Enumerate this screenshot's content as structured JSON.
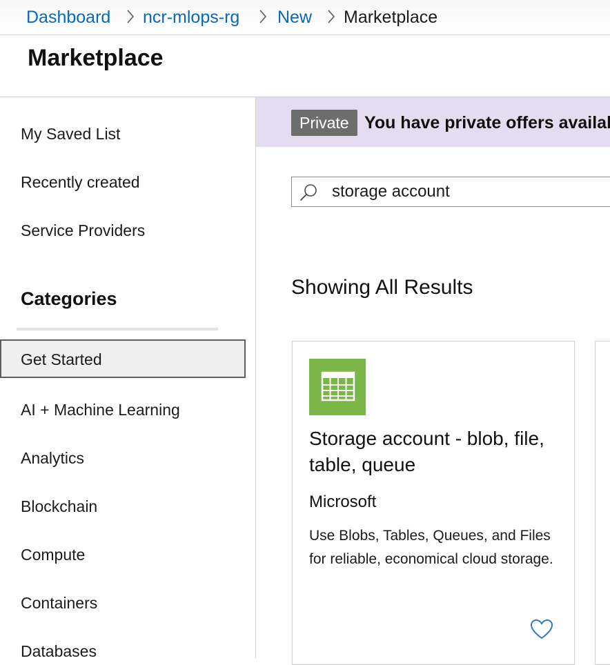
{
  "breadcrumb": {
    "items": [
      "Dashboard",
      "ncr-mlops-rg",
      "New"
    ],
    "current": "Marketplace"
  },
  "page_title": "Marketplace",
  "sidebar": {
    "top_items": [
      "My Saved List",
      "Recently created",
      "Service Providers"
    ],
    "categories_heading": "Categories",
    "categories": [
      "Get Started",
      "AI + Machine Learning",
      "Analytics",
      "Blockchain",
      "Compute",
      "Containers",
      "Databases"
    ],
    "selected_category": "Get Started"
  },
  "banner": {
    "badge": "Private",
    "text": "You have private offers available"
  },
  "search": {
    "value": "storage account",
    "icon": "search-icon"
  },
  "results_heading": "Showing All Results",
  "results": [
    {
      "title": "Storage account - blob, file, table, queue",
      "publisher": "Microsoft",
      "description": "Use Blobs, Tables, Queues, and Files for reliable, economical cloud storage.",
      "icon": "storage-table-icon",
      "icon_color": "#7ab648",
      "favorite_icon": "heart-icon"
    }
  ],
  "colors": {
    "link": "#0a68b8",
    "banner_bg": "#e4dcf0",
    "badge_bg": "#6d6d6d"
  }
}
